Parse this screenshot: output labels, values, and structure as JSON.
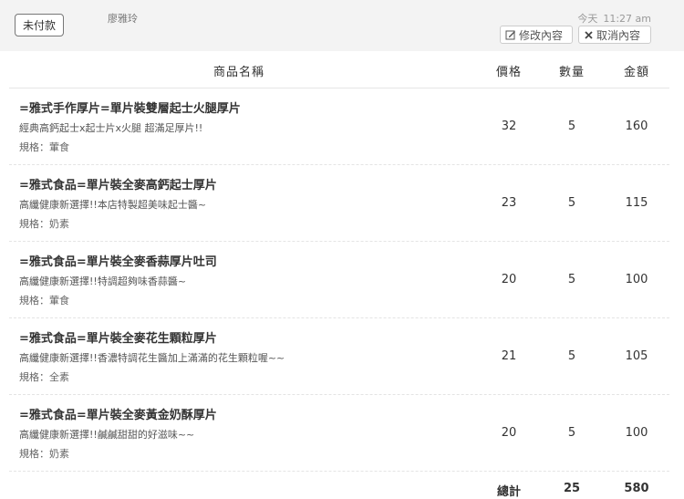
{
  "header": {
    "status": "未付款",
    "customer": "廖雅玲",
    "day": "今天",
    "time": "11:27 am",
    "edit_label": "修改內容",
    "cancel_label": "取消內容"
  },
  "table": {
    "columns": {
      "name": "商品名稱",
      "price": "價格",
      "qty": "數量",
      "amount": "金額"
    },
    "rows": [
      {
        "name": "=雅式手作厚片=單片裝雙層起士火腿厚片",
        "desc": "經典高鈣起士x起士片x火腿 超滿足厚片!!",
        "spec": "規格：葷食",
        "price": "32",
        "qty": "5",
        "amount": "160"
      },
      {
        "name": "=雅式食品=單片裝全麥高鈣起士厚片",
        "desc": "高纖健康新選擇!!本店特製超美味起士醬~",
        "spec": "規格：奶素",
        "price": "23",
        "qty": "5",
        "amount": "115"
      },
      {
        "name": "=雅式食品=單片裝全麥香蒜厚片吐司",
        "desc": "高纖健康新選擇!!特調超夠味香蒜醬~",
        "spec": "規格：葷食",
        "price": "20",
        "qty": "5",
        "amount": "100"
      },
      {
        "name": "=雅式食品=單片裝全麥花生顆粒厚片",
        "desc": "高纖健康新選擇!!香濃特調花生醬加上滿滿的花生顆粒喔~~",
        "spec": "規格：全素",
        "price": "21",
        "qty": "5",
        "amount": "105"
      },
      {
        "name": "=雅式食品=單片裝全麥黃金奶酥厚片",
        "desc": "高纖健康新選擇!!鹹鹹甜甜的好滋味~~",
        "spec": "規格：奶素",
        "price": "20",
        "qty": "5",
        "amount": "100"
      }
    ],
    "total": {
      "label": "總計",
      "qty": "25",
      "amount": "580"
    }
  }
}
